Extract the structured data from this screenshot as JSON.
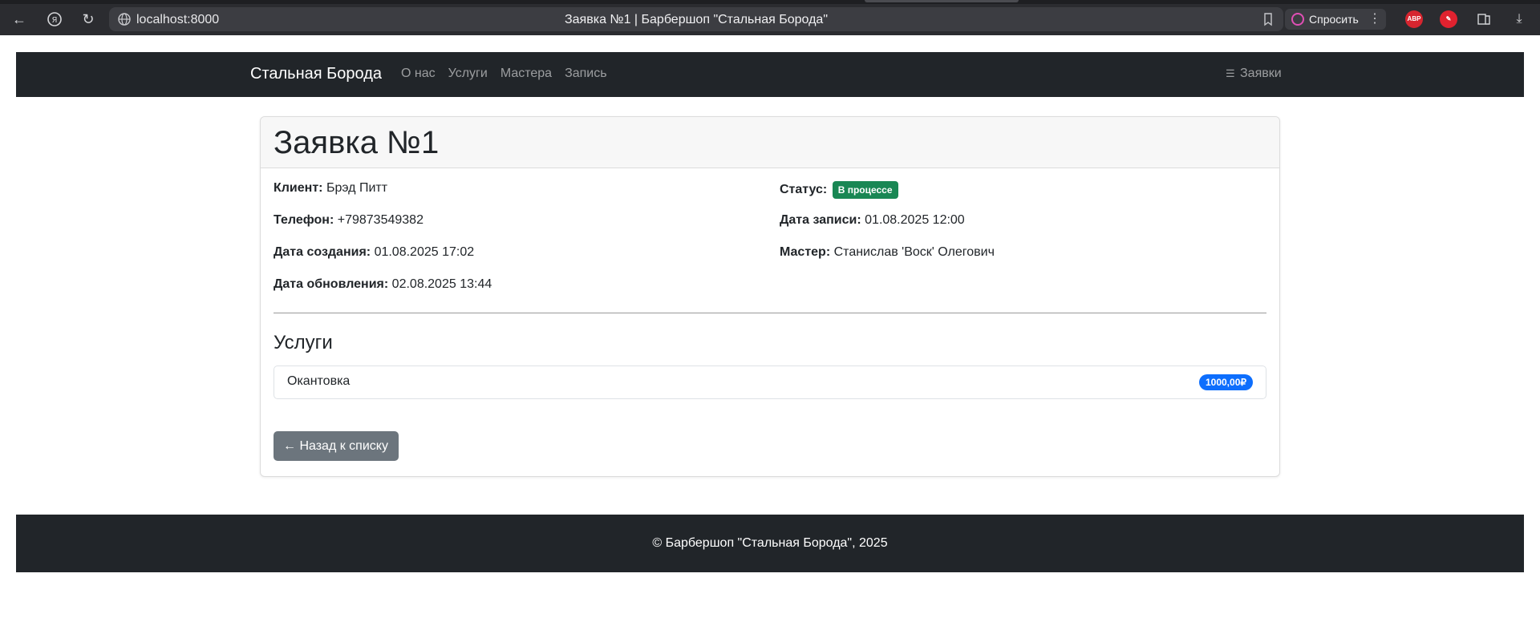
{
  "browser": {
    "url": "localhost:8000",
    "tab_title": "Заявка №1 | Барбершоп \"Стальная Борода\"",
    "ask_label": "Спросить",
    "ext_abp": "ABP"
  },
  "navbar": {
    "brand": "Стальная Борода",
    "links": [
      "О нас",
      "Услуги",
      "Мастера",
      "Запись"
    ],
    "right_link": "Заявки"
  },
  "order": {
    "title": "Заявка №1",
    "client_label": "Клиент:",
    "client": "Брэд Питт",
    "phone_label": "Телефон:",
    "phone": "+79873549382",
    "created_label": "Дата создания:",
    "created": "01.08.2025 17:02",
    "updated_label": "Дата обновления:",
    "updated": "02.08.2025 13:44",
    "status_label": "Статус:",
    "status": "В процессе",
    "appointment_label": "Дата записи:",
    "appointment": "01.08.2025 12:00",
    "master_label": "Мастер:",
    "master": "Станислав 'Воск' Олегович"
  },
  "services": {
    "title": "Услуги",
    "items": [
      {
        "name": "Окантовка",
        "price": "1000,00₽"
      }
    ]
  },
  "back_button": "← Назад к списку",
  "footer": "© Барбершоп \"Стальная Борода\", 2025",
  "colors": {
    "navbar_bg": "#212529",
    "status_badge": "#198754",
    "price_badge": "#0d6efd",
    "back_button": "#6c757d"
  }
}
